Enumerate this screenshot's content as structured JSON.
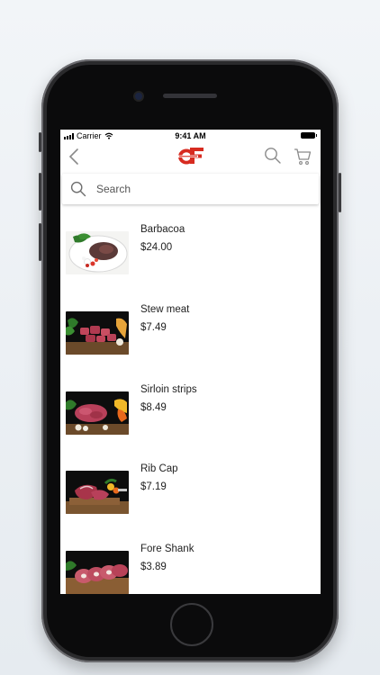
{
  "status_bar": {
    "carrier": "Carrier",
    "time": "9:41 AM"
  },
  "header": {
    "logo_icon": "brand-logo-icon",
    "back_icon": "chevron-left-icon",
    "search_icon": "search-icon",
    "cart_icon": "cart-icon"
  },
  "search": {
    "placeholder": "Search"
  },
  "products": [
    {
      "name": "Barbacoa",
      "price": "$24.00"
    },
    {
      "name": "Stew meat",
      "price": "$7.49"
    },
    {
      "name": "Sirloin strips",
      "price": "$8.49"
    },
    {
      "name": "Rib Cap",
      "price": "$7.19"
    },
    {
      "name": "Fore Shank",
      "price": "$3.89"
    }
  ],
  "colors": {
    "accent": "#d72b20",
    "text": "#222222"
  }
}
